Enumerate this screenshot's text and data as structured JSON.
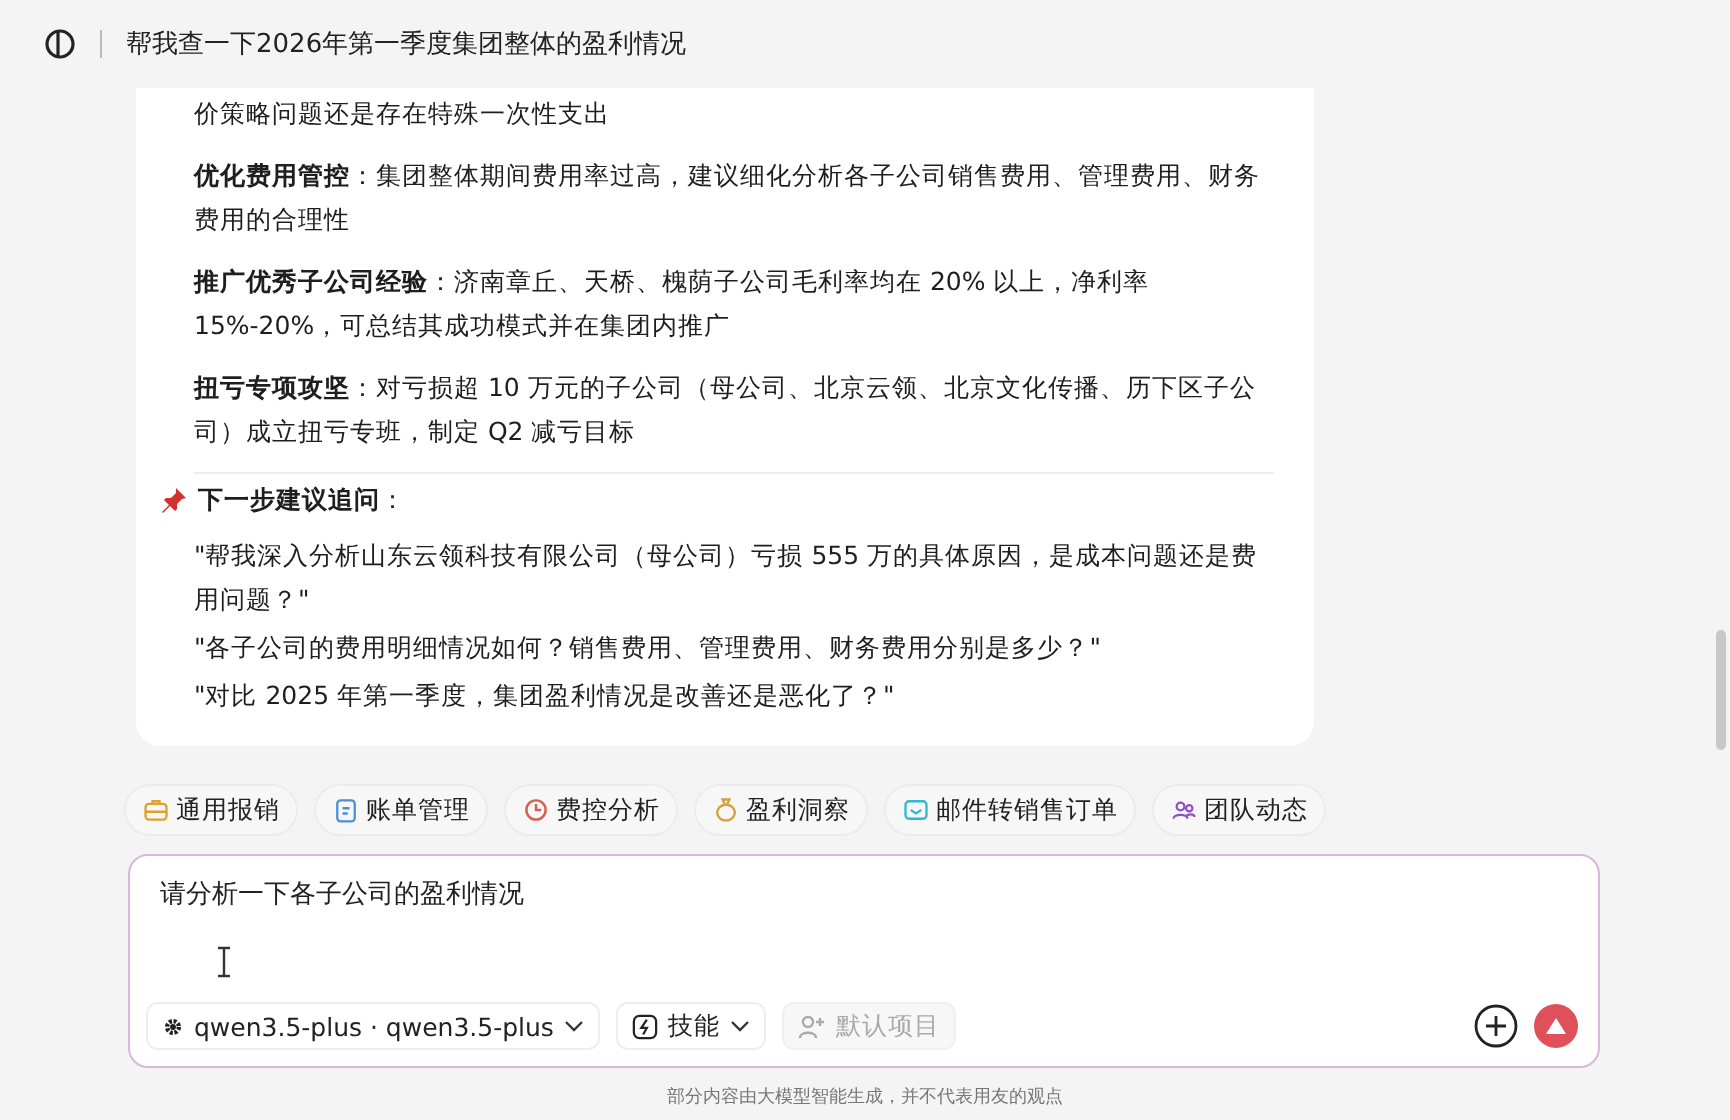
{
  "header": {
    "title": "帮我查一下2026年第一季度集团整体的盈利情况"
  },
  "answer": {
    "fragment": "价策略问题还是存在特殊一次性支出",
    "suggestions": [
      {
        "text": "**优化费用管控**：集团整体期间费用率过高，建议细化分析各子公司销售费用、管理费用、财务费用的合理性"
      },
      {
        "text": "**推广优秀子公司经验**：济南章丘、天桥、槐荫子公司毛利率均在 20% 以上，净利率 15%-20%，可总结其成功模式并在集团内推广"
      },
      {
        "text": "**扭亏专项攻坚**：对亏损超 10 万元的子公司（母公司、北京云领、北京文化传播、历下区子公司）成立扭亏专班，制定 Q2 减亏目标"
      }
    ],
    "followup_heading": "下一步建议追问",
    "followup_colon": "：",
    "followups": [
      "\"帮我深入分析山东云领科技有限公司（母公司）亏损 555 万的具体原因，是成本问题还是费用问题？\"",
      "\"各子公司的费用明细情况如何？销售费用、管理费用、财务费用分别是多少？\"",
      "\"对比 2025 年第一季度，集团盈利情况是改善还是恶化了？\""
    ]
  },
  "chips": [
    {
      "label": "通用报销",
      "color": "#e0a030"
    },
    {
      "label": "账单管理",
      "color": "#4a8fd8"
    },
    {
      "label": "费控分析",
      "color": "#d46050"
    },
    {
      "label": "盈利洞察",
      "color": "#d9a040"
    },
    {
      "label": "邮件转销售订单",
      "color": "#30b8c8"
    },
    {
      "label": "团队动态",
      "color": "#9050c0"
    }
  ],
  "composer": {
    "value": "请分析一下各子公司的盈利情况",
    "model": "qwen3.5-plus · qwen3.5-plus",
    "skills": "技能",
    "project": {
      "label": "默认项目",
      "disabled": true
    }
  },
  "footer": "部分内容由大模型智能生成，并不代表用友的观点"
}
